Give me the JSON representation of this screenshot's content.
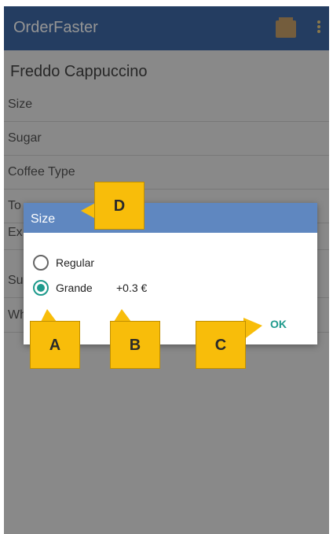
{
  "app": {
    "title": "OrderFaster",
    "icons": [
      "shopping-cart-icon",
      "more-vert-icon"
    ]
  },
  "product": {
    "name": "Freddo Cappuccino"
  },
  "options": [
    {
      "label": "Size"
    },
    {
      "label": "Sugar"
    },
    {
      "label": "Coffee Type"
    },
    {
      "label": "To"
    },
    {
      "label": "Ex"
    },
    {
      "label": "Su"
    },
    {
      "label": "Wh"
    }
  ],
  "dialog": {
    "title": "Size",
    "choices": [
      {
        "label": "Regular",
        "price": "",
        "selected": false
      },
      {
        "label": "Grande",
        "price": "+0.3 €",
        "selected": true
      }
    ],
    "ok_label": "OK"
  },
  "callouts": [
    {
      "label": "A"
    },
    {
      "label": "B"
    },
    {
      "label": "C"
    },
    {
      "label": "D"
    }
  ],
  "colors": {
    "appbar": "#3f6aa8",
    "dialog_title": "#5f87c0",
    "accent": "#1e9a8c",
    "callout": "#f8bd0a"
  }
}
